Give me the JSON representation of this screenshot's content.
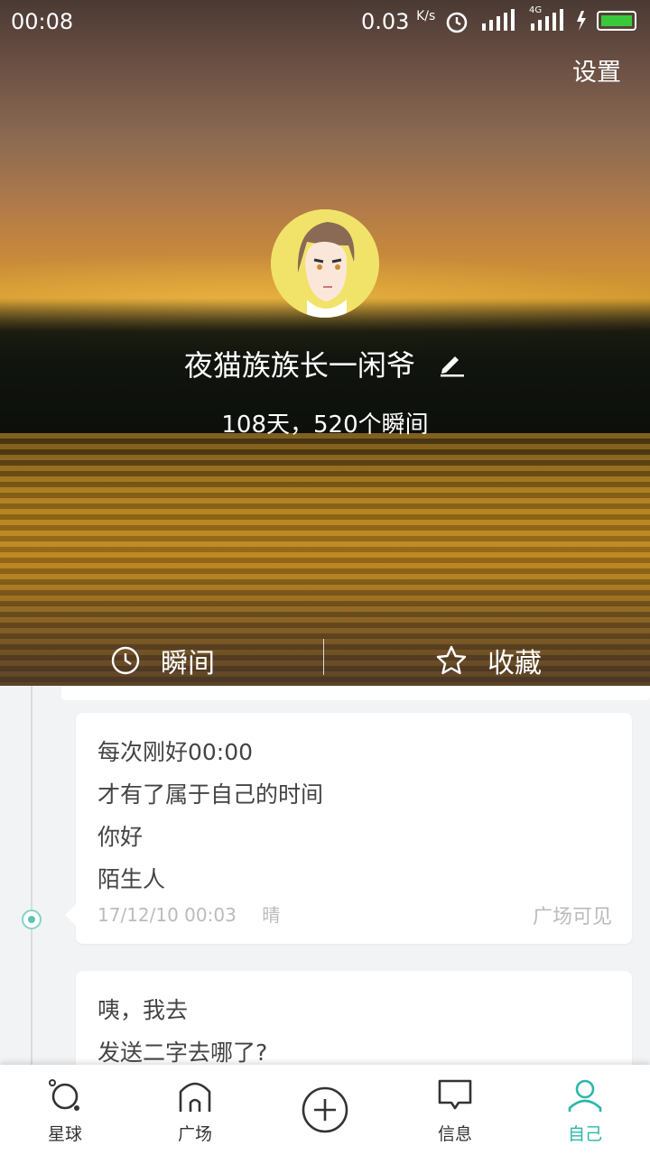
{
  "status_bar": {
    "time": "00:08",
    "speed": "0.03",
    "speed_unit": "K/s",
    "network": "4G"
  },
  "header": {
    "settings_label": "设置"
  },
  "profile": {
    "name": "夜猫族族长一闲爷",
    "stats": "108天，520个瞬间",
    "avatar_icon": "avatar-cartoon-face",
    "edit_icon": "pencil-icon"
  },
  "tabs": [
    {
      "label": "瞬间",
      "icon": "clock-icon",
      "active": true
    },
    {
      "label": "收藏",
      "icon": "star-icon",
      "active": false
    }
  ],
  "posts": [
    {
      "lines": [
        "每次刚好00:00",
        "才有了属于自己的时间",
        "你好",
        "陌生人"
      ],
      "datetime": "17/12/10 00:03",
      "weather": "晴",
      "visibility": "广场可见"
    },
    {
      "lines": [
        "咦，我去",
        "发送二字去哪了?"
      ]
    }
  ],
  "nav": [
    {
      "label": "星球",
      "icon": "planet-icon"
    },
    {
      "label": "广场",
      "icon": "home-icon"
    },
    {
      "label": "",
      "icon": "plus-circle-icon"
    },
    {
      "label": "信息",
      "icon": "message-icon"
    },
    {
      "label": "自己",
      "icon": "person-icon",
      "active": true
    }
  ],
  "colors": {
    "accent": "#2cb6a8",
    "timeline_dot": "#5bc3b6",
    "card_bg": "#ffffff",
    "page_bg": "#f2f3f4"
  }
}
